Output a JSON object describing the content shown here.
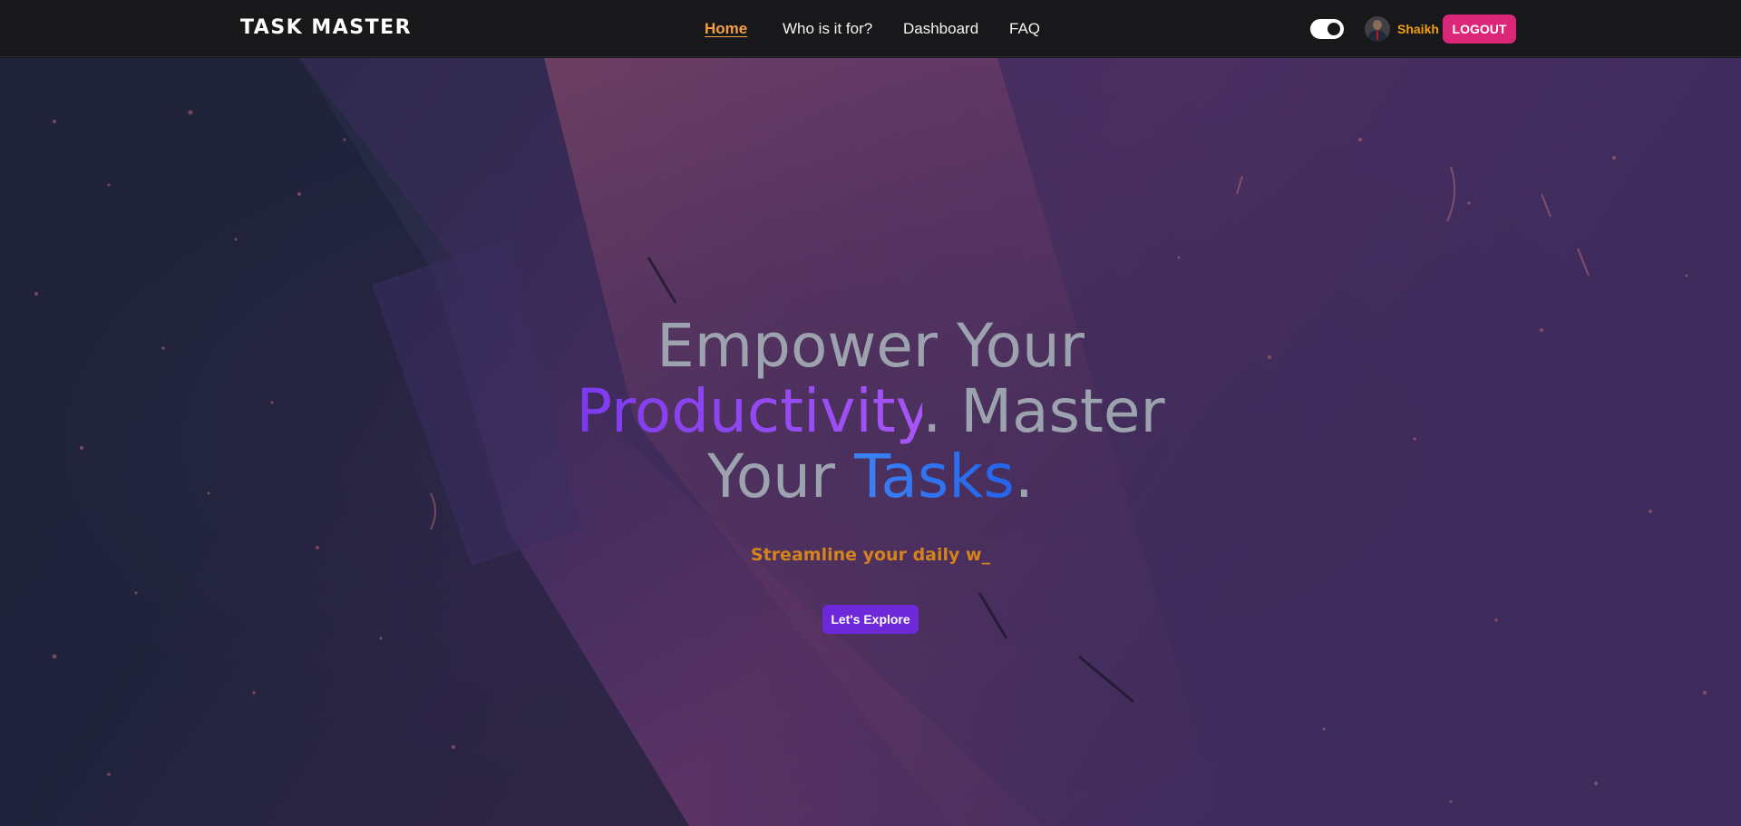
{
  "brand": "TASK MASTER",
  "nav": {
    "home": "Home",
    "who": "Who is it for?",
    "dashboard": "Dashboard",
    "faq": "FAQ"
  },
  "user": {
    "name": "Shaikh",
    "logout_label": "LOGOUT",
    "theme_toggle_on": true
  },
  "hero": {
    "line1": "Empower Your",
    "productivity": "Productivity",
    "after_productivity": ". Master",
    "your": "Your ",
    "tasks": "Tasks",
    "period": ".",
    "subline": "Streamline your daily w_",
    "cta_label": "Let's Explore"
  },
  "colors": {
    "accent_orange": "#f59e42",
    "logout_pink": "#db2777",
    "cta_purple": "#6d28d9",
    "headline_gray": "#9ca3af",
    "productivity_purple": "#8b3fe6",
    "tasks_blue": "#2f6df0"
  },
  "icons": {
    "theme_toggle": "toggle-switch-icon",
    "avatar": "user-avatar-photo"
  }
}
